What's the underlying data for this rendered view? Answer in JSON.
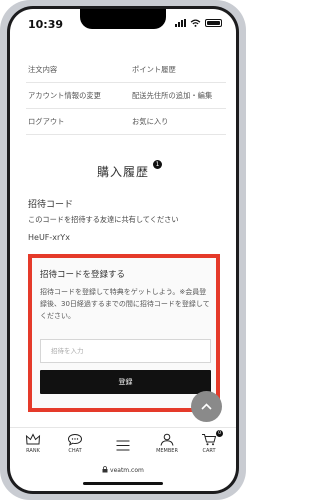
{
  "status_bar": {
    "time": "10:39"
  },
  "account_menu": [
    {
      "left": "注文内容",
      "right": "ポイント履歴"
    },
    {
      "left": "アカウント情報の変更",
      "right": "配送先住所の追加・編集"
    },
    {
      "left": "ログアウト",
      "right": "お気に入り"
    }
  ],
  "page": {
    "title": "購入履歴",
    "title_badge": "1"
  },
  "invite": {
    "heading": "招待コード",
    "description": "このコードを招待する友達に共有してください",
    "code": "HeUF-xrYx"
  },
  "register": {
    "title": "招待コードを登録する",
    "description": "招待コードを登録して特典をゲットしよう。※会員登録後、30日経過するまでの間に招待コードを登録してください。",
    "input_placeholder": "招待を入力",
    "button_label": "登録"
  },
  "bottom_nav": {
    "rank": "RANK",
    "chat": "CHAT",
    "member": "MEMBER",
    "cart": "CART",
    "cart_count": "0"
  },
  "browser": {
    "url": "veatm.com"
  },
  "colors": {
    "highlight": "#e53a2a",
    "button": "#111111"
  }
}
